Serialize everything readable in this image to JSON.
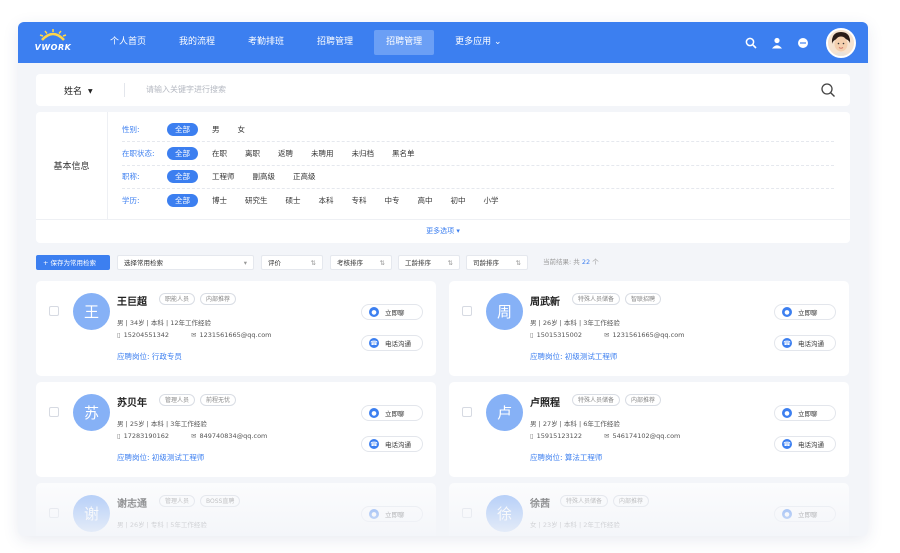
{
  "brand": {
    "name": "VWORK"
  },
  "nav": {
    "items": [
      {
        "label": "个人首页"
      },
      {
        "label": "我的流程"
      },
      {
        "label": "考勤排班"
      },
      {
        "label": "招聘管理"
      },
      {
        "label": "招聘管理",
        "active": true
      },
      {
        "label": "更多应用 ⌄"
      }
    ],
    "icons": [
      "search-icon",
      "user-icon",
      "message-icon",
      "avatar"
    ]
  },
  "search": {
    "field_label": "姓名",
    "placeholder": "请输入关键字进行搜索"
  },
  "filter": {
    "section_label": "基本信息",
    "rows": [
      {
        "title": "性别:",
        "options": [
          "全部",
          "男",
          "女"
        ]
      },
      {
        "title": "在职状态:",
        "options": [
          "全部",
          "在职",
          "离职",
          "返聘",
          "未聘用",
          "未归档",
          "黑名单"
        ]
      },
      {
        "title": "职称:",
        "options": [
          "全部",
          "工程师",
          "副高级",
          "正高级"
        ]
      },
      {
        "title": "学历:",
        "options": [
          "全部",
          "博士",
          "研究生",
          "硕士",
          "本科",
          "专科",
          "中专",
          "高中",
          "初中",
          "小学"
        ]
      }
    ],
    "more_label": "更多选项 ▾"
  },
  "toolbar": {
    "save_label": "+ 保存为常用检索",
    "select_label": "选择常用检索",
    "sort_items": [
      "评价",
      "考核排序",
      "工龄排序",
      "司龄排序"
    ],
    "sort_arrow": "⇅",
    "result_prefix": "当前结果: 共",
    "result_count": "22",
    "result_suffix": "个"
  },
  "cards": [
    {
      "avatar": "王",
      "name": "王巨超",
      "tags": [
        "职能人员",
        "内部推荐"
      ],
      "meta": "男 | 34岁 | 本科 | 12年工作经验",
      "phone": "15204551342",
      "email": "1231561665@qq.com",
      "job": "应聘岗位: 行政专员",
      "btn_chat": "立即聊",
      "btn_call": "电话沟通"
    },
    {
      "avatar": "周",
      "name": "周武新",
      "tags": [
        "特殊人员储备",
        "智联招聘"
      ],
      "meta": "男 | 26岁 | 本科 | 3年工作经验",
      "phone": "15015315002",
      "email": "1231561665@qq.com",
      "job": "应聘岗位: 初级测试工程师",
      "btn_chat": "立即聊",
      "btn_call": "电话沟通"
    },
    {
      "avatar": "苏",
      "name": "苏贝年",
      "tags": [
        "管理人员",
        "前程无忧"
      ],
      "meta": "男 | 25岁 | 本科 | 3年工作经验",
      "phone": "17283190162",
      "email": "849740834@qq.com",
      "job": "应聘岗位: 初级测试工程师",
      "btn_chat": "立即聊",
      "btn_call": "电话沟通"
    },
    {
      "avatar": "卢",
      "name": "卢照程",
      "tags": [
        "特殊人员储备",
        "内部推荐"
      ],
      "meta": "男 | 27岁 | 本科 | 6年工作经验",
      "phone": "15915123122",
      "email": "546174102@qq.com",
      "job": "应聘岗位: 算法工程师",
      "btn_chat": "立即聊",
      "btn_call": "电话沟通"
    },
    {
      "avatar": "谢",
      "name": "谢志通",
      "tags": [
        "管理人员",
        "BOSS直聘"
      ],
      "meta": "男 | 26岁 | 专科 | 5年工作经验",
      "phone": "",
      "email": "",
      "job": "",
      "btn_chat": "立即聊",
      "btn_call": ""
    },
    {
      "avatar": "徐",
      "name": "徐茜",
      "tags": [
        "特殊人员储备",
        "内部推荐"
      ],
      "meta": "女 | 23岁 | 本科 | 2年工作经验",
      "phone": "",
      "email": "",
      "job": "",
      "btn_chat": "立即聊",
      "btn_call": ""
    }
  ],
  "colors": {
    "primary": "#3c7ff0",
    "nav_active": "#6b9ff5",
    "avatar": "#86b1f6",
    "background": "#f3f5f9"
  }
}
